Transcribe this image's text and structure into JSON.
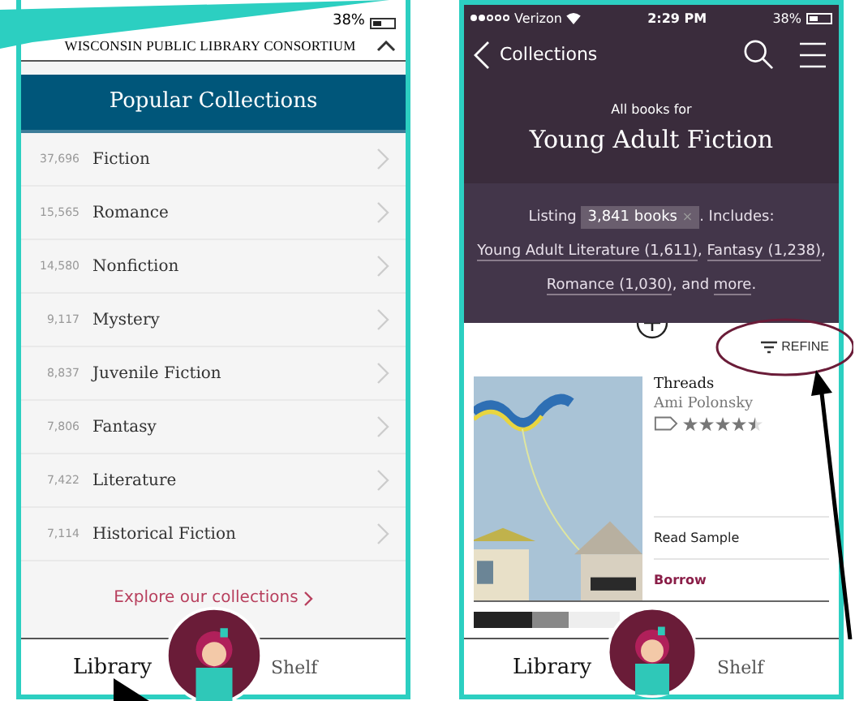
{
  "left_screen": {
    "status_bar": {
      "battery": "38%"
    },
    "header": {
      "title": "WISCONSIN PUBLIC LIBRARY CONSORTIUM"
    },
    "collections_heading": "Popular Collections",
    "collections": [
      {
        "count": "37,696",
        "name": "Fiction"
      },
      {
        "count": "15,565",
        "name": "Romance"
      },
      {
        "count": "14,580",
        "name": "Nonfiction"
      },
      {
        "count": "9,117",
        "name": "Mystery"
      },
      {
        "count": "8,837",
        "name": "Juvenile Fiction"
      },
      {
        "count": "7,806",
        "name": "Fantasy"
      },
      {
        "count": "7,422",
        "name": "Literature"
      },
      {
        "count": "7,114",
        "name": "Historical Fiction"
      }
    ],
    "explore_link": "Explore our collections",
    "tabs": [
      {
        "label": "Library",
        "selected": true
      },
      {
        "label": "Shelf",
        "selected": false
      }
    ]
  },
  "right_screen": {
    "status_bar": {
      "carrier": "Verizon",
      "time": "2:29 PM",
      "battery": "38%"
    },
    "nav": {
      "back": "Collections"
    },
    "subtitle": "All books for",
    "title": "Young Adult Fiction",
    "summary": [
      {
        "kind": "text",
        "text": "Listing "
      },
      {
        "kind": "chip",
        "text": "3,841 books",
        "remove_mark": "×"
      },
      {
        "kind": "text",
        "text": ". Includes: "
      },
      {
        "kind": "link",
        "text": "Young Adult Literature (1,611)"
      },
      {
        "kind": "text",
        "text": ", "
      },
      {
        "kind": "link",
        "text": "Fantasy (1,238)"
      },
      {
        "kind": "text",
        "text": ", "
      },
      {
        "kind": "link",
        "text": "Romance (1,030)"
      },
      {
        "kind": "text",
        "text": ", and "
      },
      {
        "kind": "link",
        "text": "more"
      },
      {
        "kind": "text",
        "text": "."
      }
    ],
    "refine": "REFINE",
    "book": {
      "title": "Threads",
      "author": "Ami Polonsky",
      "stars": 4.5,
      "actions": [
        {
          "kind": "plain",
          "label": "Read Sample"
        },
        {
          "kind": "accent",
          "label": "Borrow"
        }
      ]
    },
    "tabs": [
      {
        "label": "Library",
        "selected": true
      },
      {
        "label": "Shelf",
        "selected": false
      }
    ]
  }
}
